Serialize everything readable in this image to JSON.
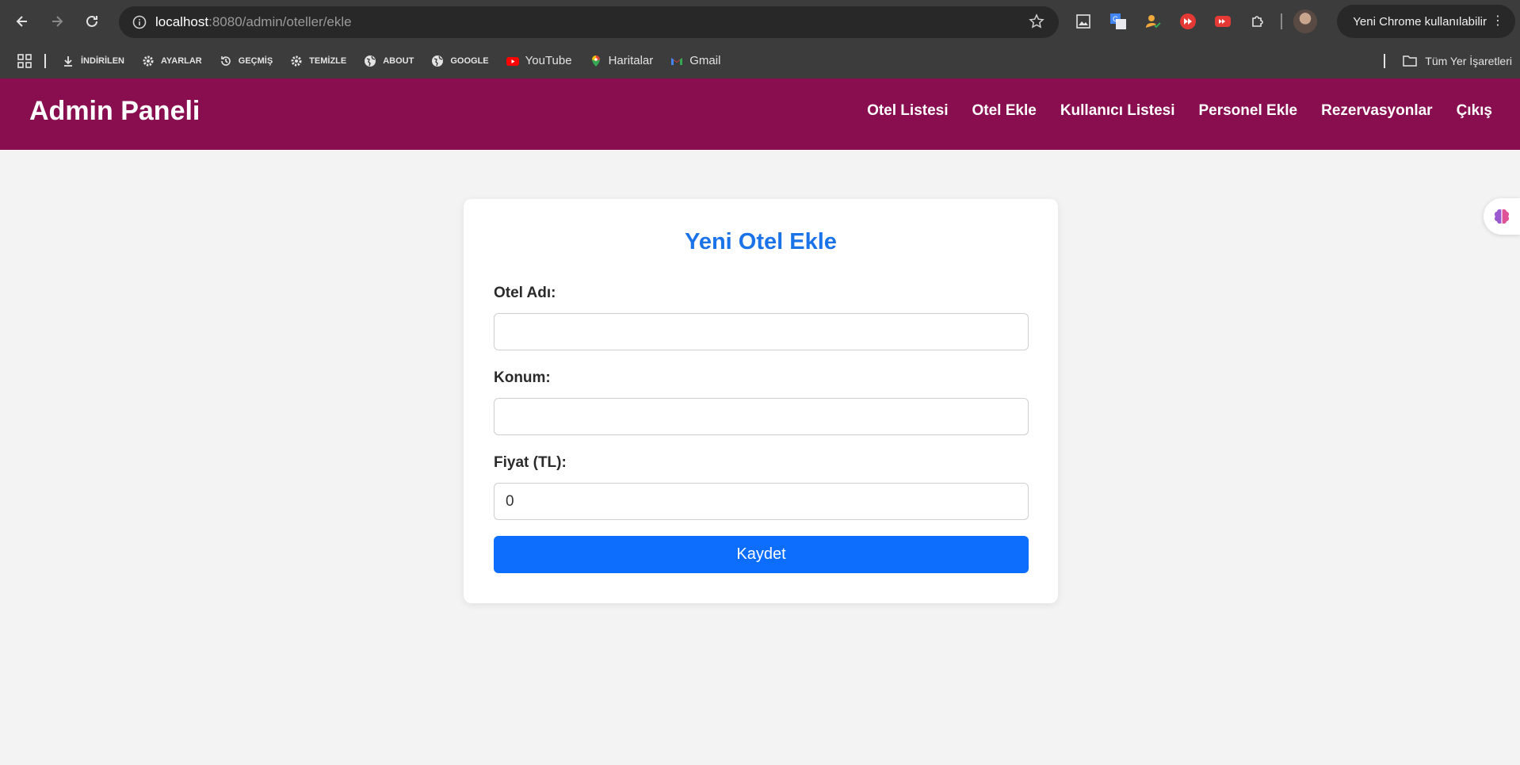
{
  "browser": {
    "url_host": "localhost",
    "url_path": ":8080/admin/oteller/ekle",
    "profile_label": "Yeni Chrome kullanılabilir",
    "bookmarks": [
      {
        "label": "İNDİRİLEN",
        "icon": "download-icon"
      },
      {
        "label": "AYARLAR",
        "icon": "gear-icon"
      },
      {
        "label": "GEÇMİŞ",
        "icon": "history-icon"
      },
      {
        "label": "TEMİZLE",
        "icon": "gear-icon"
      },
      {
        "label": "ABOUT",
        "icon": "globe-icon"
      },
      {
        "label": "GOOGLE",
        "icon": "globe-icon"
      },
      {
        "label": "YouTube",
        "icon": "youtube-icon"
      },
      {
        "label": "Haritalar",
        "icon": "maps-icon"
      },
      {
        "label": "Gmail",
        "icon": "gmail-icon"
      }
    ],
    "all_bookmarks": "Tüm Yer İşaretleri"
  },
  "header": {
    "brand": "Admin Paneli",
    "nav": [
      "Otel Listesi",
      "Otel Ekle",
      "Kullanıcı Listesi",
      "Personel Ekle",
      "Rezervasyonlar",
      "Çıkış"
    ]
  },
  "form": {
    "title": "Yeni Otel Ekle",
    "fields": [
      {
        "label": "Otel Adı:",
        "value": ""
      },
      {
        "label": "Konum:",
        "value": ""
      },
      {
        "label": "Fiyat (TL):",
        "value": "0"
      }
    ],
    "submit": "Kaydet"
  },
  "colors": {
    "header_bg": "#880e4f",
    "title": "#1a73e8",
    "button": "#0d6efd"
  }
}
